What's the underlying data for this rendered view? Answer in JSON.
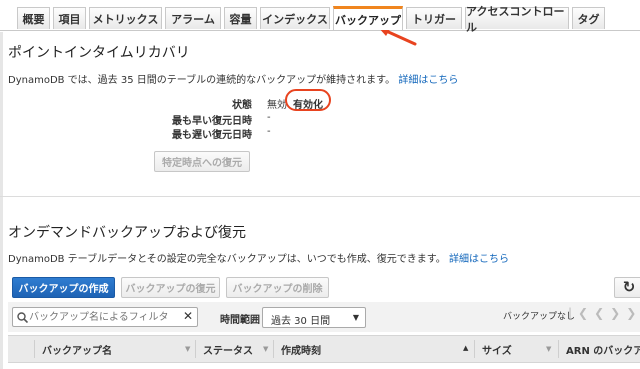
{
  "tabs": [
    "概要",
    "項目",
    "メトリックス",
    "アラーム",
    "容量",
    "インデックス",
    "バックアップ",
    "トリガー",
    "アクセスコントロール",
    "タグ"
  ],
  "active_tab": "バックアップ",
  "pitr": {
    "title": "ポイントインタイムリカバリ",
    "description": "DynamoDB では、過去 35 日間のテーブルの連続的なバックアップが維持されます。",
    "details_link": "詳細はこちら",
    "status_label": "状態",
    "status_value": "無効",
    "enable_link": "有効化",
    "earliest_label": "最も早い復元日時",
    "earliest_value": "-",
    "latest_label": "最も遅い復元日時",
    "latest_value": "-",
    "restore_button": "特定時点への復元"
  },
  "ondemand": {
    "title": "オンデマンドバックアップおよび復元",
    "description": "DynamoDB テーブルデータとその設定の完全なバックアップは、いつでも作成、復元できます。",
    "details_link": "詳細はこちら",
    "create_button": "バックアップの作成",
    "restore_button": "バックアップの復元",
    "delete_button": "バックアップの削除"
  },
  "filter": {
    "search_placeholder": "バックアップ名によるフィルタ",
    "time_range_label": "時間範囲",
    "time_range_value": "過去 30 日間",
    "pagination_text": "バックアップなし"
  },
  "table": {
    "columns": [
      "バックアップ名",
      "ステータス",
      "作成時刻",
      "サイズ",
      "ARN のバックアップ"
    ]
  },
  "colors": {
    "accent": "#f0851e",
    "link": "#1166bb",
    "primary": "#1e63b5",
    "annotation": "#e8431f"
  },
  "icons": [
    "refresh-icon",
    "search-icon",
    "clear-icon",
    "first-page-icon",
    "prev-page-icon",
    "next-page-icon",
    "last-page-icon"
  ]
}
